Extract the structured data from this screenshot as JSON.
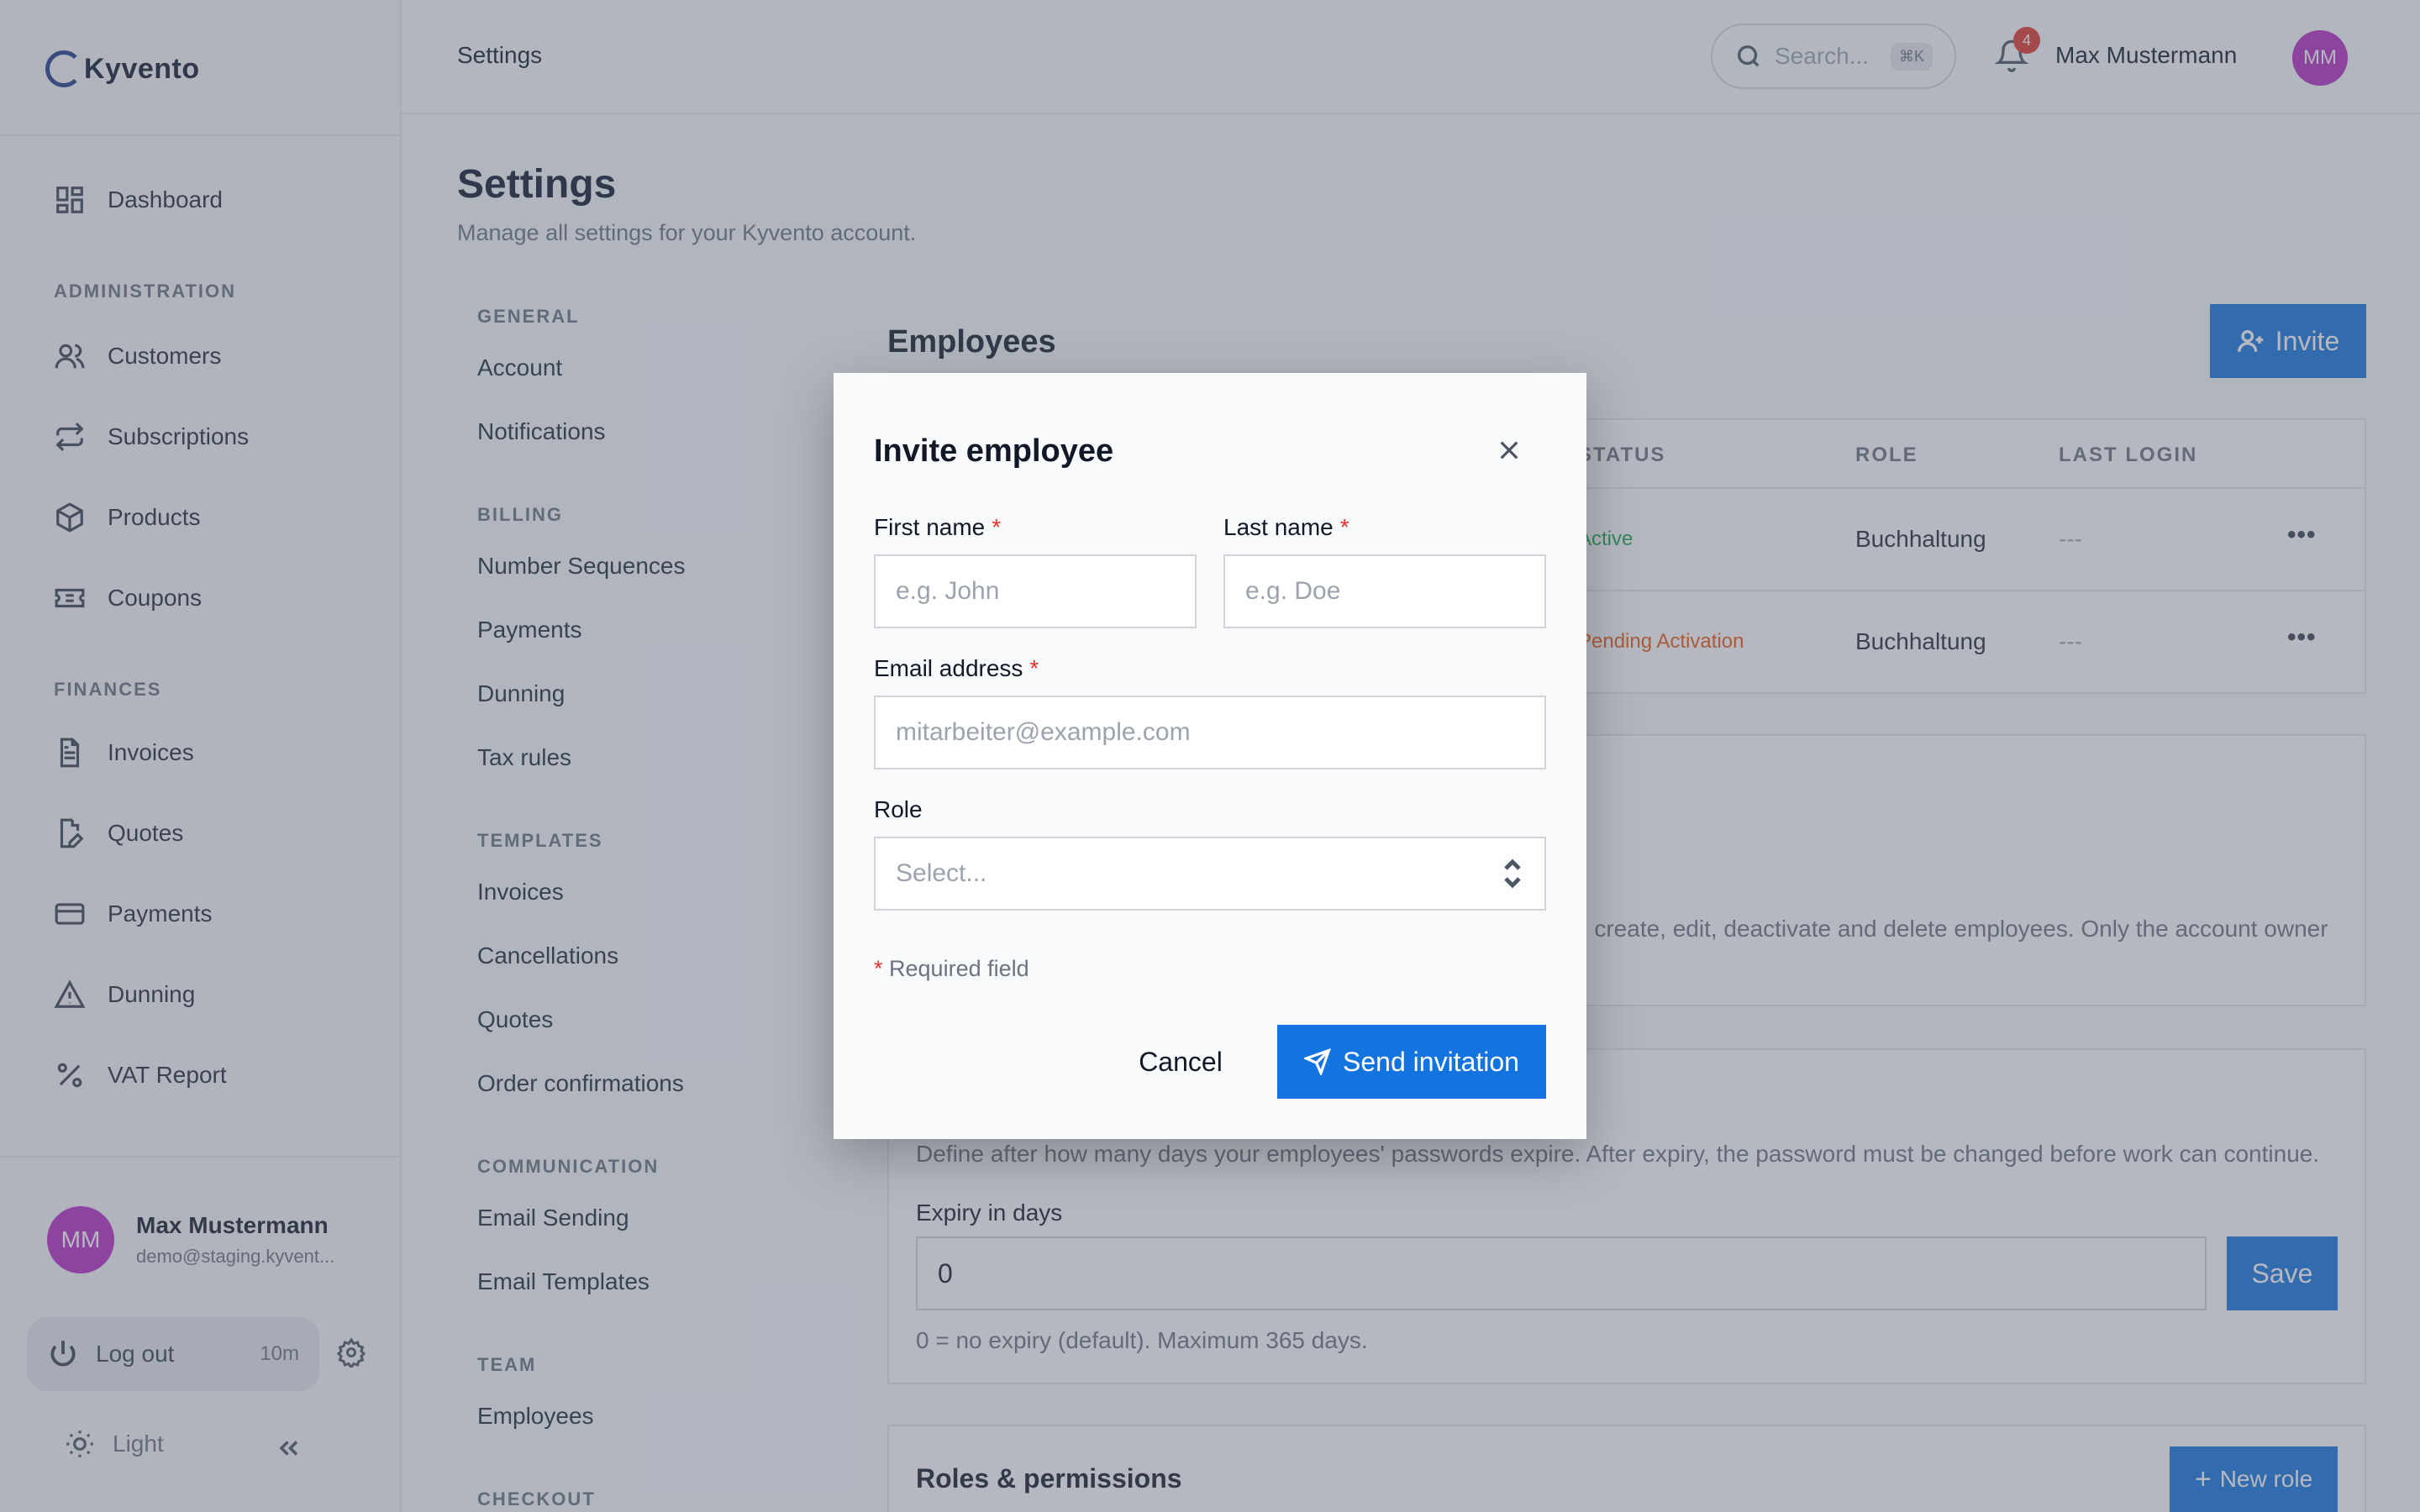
{
  "app": {
    "logo_text": "Kyvento"
  },
  "sidebar": {
    "dashboard": "Dashboard",
    "sections": {
      "administration": "ADMINISTRATION",
      "finances": "FINANCES"
    },
    "admin_items": [
      "Customers",
      "Subscriptions",
      "Products",
      "Coupons"
    ],
    "finance_items": [
      "Invoices",
      "Quotes",
      "Payments",
      "Dunning",
      "VAT Report"
    ],
    "user": {
      "initials": "MM",
      "name": "Max Mustermann",
      "email": "demo@staging.kyvent..."
    },
    "logout": {
      "label": "Log out",
      "timer": "10m"
    },
    "theme_label": "Light"
  },
  "topbar": {
    "breadcrumb": "Settings",
    "search_placeholder": "Search...",
    "search_shortcut": "⌘K",
    "notifications_count": "4",
    "user_name": "Max Mustermann",
    "user_initials": "MM"
  },
  "page": {
    "title": "Settings",
    "subtitle": "Manage all settings for your Kyvento account."
  },
  "settings_nav": {
    "general": {
      "title": "GENERAL",
      "items": [
        "Account",
        "Notifications"
      ]
    },
    "billing": {
      "title": "BILLING",
      "items": [
        "Number Sequences",
        "Payments",
        "Dunning",
        "Tax rules"
      ]
    },
    "templates": {
      "title": "TEMPLATES",
      "items": [
        "Invoices",
        "Cancellations",
        "Quotes",
        "Order confirmations"
      ]
    },
    "communication": {
      "title": "COMMUNICATION",
      "items": [
        "Email Sending",
        "Email Templates"
      ]
    },
    "team": {
      "title": "TEAM",
      "items": [
        "Employees"
      ]
    },
    "checkout": {
      "title": "CHECKOUT"
    }
  },
  "employees": {
    "title": "Employees",
    "invite_label": "Invite",
    "columns": {
      "status": "STATUS",
      "role": "ROLE",
      "last_login": "LAST LOGIN"
    },
    "rows": [
      {
        "status": "Active",
        "role": "Buchhaltung",
        "last_login": "---"
      },
      {
        "status": "Pending Activation",
        "role": "Buchhaltung",
        "last_login": "---"
      }
    ],
    "status_colors": {
      "active": "#16a34a",
      "pending": "#ea580c"
    }
  },
  "admin_card": {
    "text": "n create, edit, deactivate and delete employees. Only the account owner"
  },
  "password_card": {
    "description": "Define after how many days your employees' passwords expire. After expiry, the password must be changed before work can continue.",
    "expiry_label": "Expiry in days",
    "expiry_value": "0",
    "save_label": "Save",
    "hint": "0 = no expiry (default). Maximum 365 days."
  },
  "roles_card": {
    "title": "Roles & permissions",
    "new_role_label": "New role"
  },
  "modal": {
    "title": "Invite employee",
    "first_name_label": "First name",
    "first_name_placeholder": "e.g. John",
    "last_name_label": "Last name",
    "last_name_placeholder": "e.g. Doe",
    "email_label": "Email address",
    "email_placeholder": "mitarbeiter@example.com",
    "role_label": "Role",
    "role_placeholder": "Select...",
    "required_marker": "*",
    "required_note": "Required field",
    "cancel_label": "Cancel",
    "send_label": "Send invitation"
  },
  "colors": {
    "primary": "#1374e0",
    "avatar": "#b62cc4",
    "badge": "#e2362b"
  }
}
